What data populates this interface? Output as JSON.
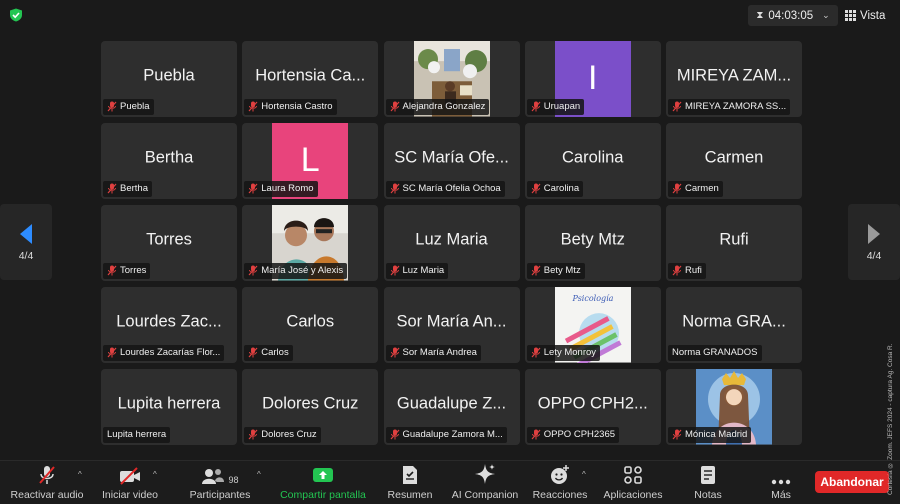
{
  "header": {
    "timer": "04:03:05",
    "view_label": "Vista"
  },
  "colors": {
    "tile_bg": "#2e2e2e",
    "laura_avatar": "#e8447c",
    "uruapan_avatar": "#7b4fc9",
    "share_green": "#23c552",
    "leave_red": "#e02828",
    "muted_red": "#e04040"
  },
  "pagination": {
    "left": "4/4",
    "right": "4/4"
  },
  "participants": [
    {
      "big": "Puebla",
      "plate": "Puebla",
      "muted": true
    },
    {
      "big": "Hortensia Ca...",
      "plate": "Hortensia Castro",
      "muted": true
    },
    {
      "big": "",
      "plate": "Alejandra Gonzalez",
      "muted": true,
      "photo": "altar-photo"
    },
    {
      "big": "",
      "plate": "Uruapan",
      "muted": true,
      "avatar_letter": "I"
    },
    {
      "big": "MIREYA ZAM...",
      "plate": "MIREYA ZAMORA SS...",
      "muted": true
    },
    {
      "big": "Bertha",
      "plate": "Bertha",
      "muted": true
    },
    {
      "big": "",
      "plate": "Laura Romo",
      "muted": true,
      "avatar_letter": "L"
    },
    {
      "big": "SC María Ofe...",
      "plate": "SC María Ofelia Ochoa",
      "muted": true
    },
    {
      "big": "Carolina",
      "plate": "Carolina",
      "muted": true
    },
    {
      "big": "Carmen",
      "plate": "Carmen",
      "muted": true
    },
    {
      "big": "Torres",
      "plate": "Torres",
      "muted": true
    },
    {
      "big": "",
      "plate": "María José y Alexis",
      "muted": true,
      "photo": "couple-photo"
    },
    {
      "big": "Luz Maria",
      "plate": "Luz Maria",
      "muted": true
    },
    {
      "big": "Bety Mtz",
      "plate": "Bety Mtz",
      "muted": true
    },
    {
      "big": "Rufi",
      "plate": "Rufi",
      "muted": true
    },
    {
      "big": "Lourdes Zac...",
      "plate": "Lourdes Zacarías Flor...",
      "muted": true
    },
    {
      "big": "Carlos",
      "plate": "Carlos",
      "muted": true
    },
    {
      "big": "Sor María An...",
      "plate": "Sor María Andrea",
      "muted": true
    },
    {
      "big": "",
      "plate": "Lety Monroy",
      "muted": true,
      "photo": "psychology-logo"
    },
    {
      "big": "Norma GRA...",
      "plate": "Norma GRANADOS",
      "muted": false
    },
    {
      "big": "Lupita herrera",
      "plate": "Lupita herrera",
      "muted": false
    },
    {
      "big": "Dolores Cruz",
      "plate": "Dolores Cruz",
      "muted": true
    },
    {
      "big": "Guadalupe Z...",
      "plate": "Guadalupe Zamora M...",
      "muted": true
    },
    {
      "big": "OPPO CPH2...",
      "plate": "OPPO CPH2365",
      "muted": true
    },
    {
      "big": "",
      "plate": "Mónica Madrid",
      "muted": true,
      "photo": "virgin-image"
    }
  ],
  "toolbar": {
    "audio": "Reactivar audio",
    "video": "Iniciar video",
    "participants": "Participantes",
    "participants_count": "98",
    "share": "Compartir pantalla",
    "summary": "Resumen",
    "ai": "AI Companion",
    "reactions": "Reacciones",
    "apps": "Aplicaciones",
    "notes": "Notas",
    "more": "Más",
    "leave": "Abandonar"
  },
  "watermark": "Cortesía ® Zoom. JEFS 2024 - captura Ag. Cosa R."
}
